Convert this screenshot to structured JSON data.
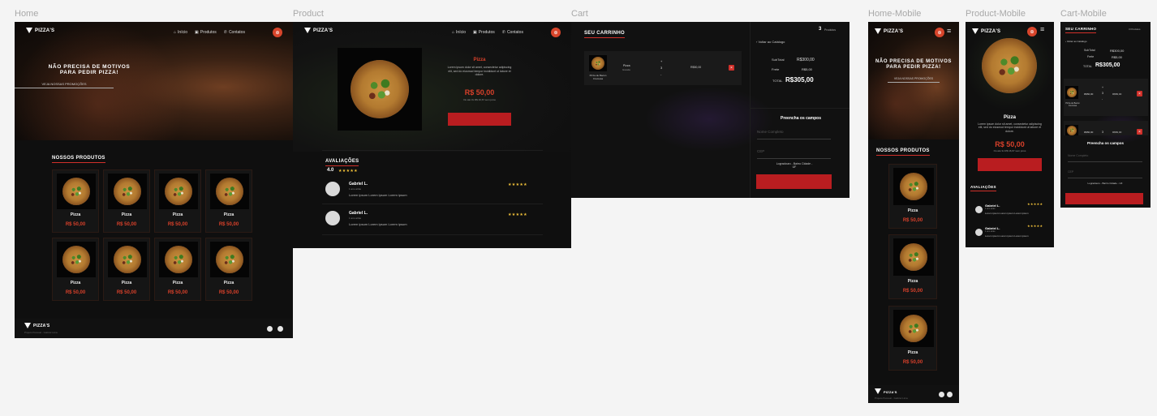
{
  "frames": {
    "home": "Home",
    "product": "Product",
    "cart": "Cart",
    "home_mobile": "Home-Mobile",
    "product_mobile": "Product-Mobile",
    "cart_mobile": "Cart-Mobile"
  },
  "brand": {
    "logo_text": "PIZZA'S",
    "logo_icon": "pizza-slice-icon",
    "accent": "#d0302a"
  },
  "nav": {
    "inicio": "Início",
    "produtos": "Produtos",
    "contatos": "Contatos"
  },
  "hero": {
    "title_line1": "NÃO PRECISA DE MOTIVOS",
    "title_line2": "PARA PEDIR PIZZA!",
    "link": "VEJA NOSSAS PROMOÇÕES"
  },
  "products_section": {
    "title": "NOSSOS PRODUTOS"
  },
  "products": [
    {
      "name": "Pizza",
      "price": "R$ 50,00"
    },
    {
      "name": "Pizza",
      "price": "R$ 50,00"
    },
    {
      "name": "Pizza",
      "price": "R$ 50,00"
    },
    {
      "name": "Pizza",
      "price": "R$ 50,00"
    },
    {
      "name": "Pizza",
      "price": "R$ 50,00"
    },
    {
      "name": "Pizza",
      "price": "R$ 50,00"
    },
    {
      "name": "Pizza",
      "price": "R$ 50,00"
    },
    {
      "name": "Pizza",
      "price": "R$ 50,00"
    }
  ],
  "footer": {
    "logo": "PIZZA'S",
    "copy": "Projeto Pessoal - Gabriel Lima"
  },
  "product_page": {
    "title": "Pizza",
    "description": "Lorem ipsum dolor sit amet, consectetur adipiscing elit, sed do eiusmod tempor incididunt ut labore et dolore.",
    "price": "R$ 50,00",
    "installments": "Ou até 3x R$ 16,67 sem juros",
    "reviews_title": "AVALIAÇÕES",
    "rating": "4.0",
    "stars": "★★★★★",
    "reviews": [
      {
        "name": "Gabriel L.",
        "date": "1 ano atrás",
        "text": "Lorem ipsum Lorem ipsum Lorem ipsum",
        "stars": "★★★★★"
      },
      {
        "name": "Gabriel L.",
        "date": "1 ano atrás",
        "text": "Lorem ipsum Lorem ipsum Lorem ipsum",
        "stars": "★★★★★"
      }
    ]
  },
  "cart_page": {
    "title": "SEU CARRINHO",
    "count": "3",
    "count_label": "Produtos",
    "back": "Voltar ao Catálogo",
    "item_name": "Pizza de Bacon Cremosa",
    "item_name_short": "Pizza",
    "item_variant": "Grande",
    "item_price": "R$50,00",
    "qty_plus": "+",
    "qty_value": "3",
    "qty_minus": "-",
    "remove": "Remover",
    "subtotal_label": "SubTotal",
    "subtotal_value": "R$300,00",
    "frete_label": "Frete",
    "frete_value": "R$5,00",
    "total_label": "TOTAL",
    "total_value": "R$305,00",
    "form_title": "Preencha os campos",
    "name_placeholder": "Nome Completo",
    "cep_placeholder": "CEP",
    "address": "Logradouro - Bairro Cidade - UF"
  },
  "mobile": {
    "cart_subtotal_label": "SubTotal",
    "cart_subtotal_value": "R$300,00",
    "cart_frete_label": "Frete",
    "cart_frete_value": "R$5,00",
    "cart_total_label": "TOTAL",
    "cart_total_value": "R$305,00"
  }
}
